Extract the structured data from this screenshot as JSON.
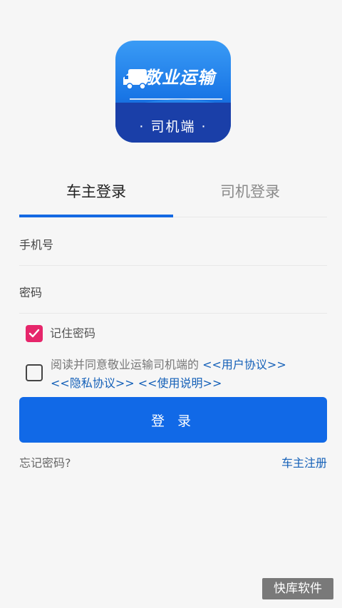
{
  "logo": {
    "title": "敬业运输",
    "subtitle": "· 司机端 ·"
  },
  "tabs": [
    {
      "label": "车主登录",
      "active": true
    },
    {
      "label": "司机登录",
      "active": false
    }
  ],
  "form": {
    "phone_placeholder": "手机号",
    "password_placeholder": "密码",
    "remember_label": "记住密码",
    "remember_checked": true,
    "agree_checked": false,
    "agree_prefix": "阅读并同意敬业运输司机端的 ",
    "user_agreement": "<<用户协议>>",
    "privacy_agreement": "<<隐私协议>>",
    "usage_instructions": "<<使用说明>>",
    "login_label": "登 录"
  },
  "footer": {
    "forgot_label": "忘记密码?",
    "register_label": "车主注册"
  },
  "watermark": "快库软件",
  "colors": {
    "primary": "#1169e7",
    "checkbox": "#e6266b",
    "link": "#1460b8"
  }
}
